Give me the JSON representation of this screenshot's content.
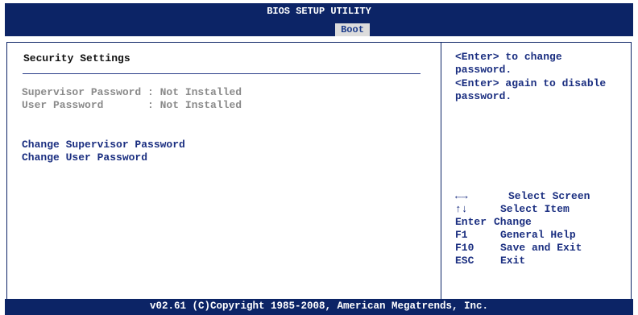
{
  "header": {
    "title": "BIOS SETUP UTILITY",
    "active_tab": "Boot"
  },
  "main": {
    "section_title": "Security Settings",
    "info": [
      "Supervisor Password : Not Installed",
      "User Password       : Not Installed"
    ],
    "menu_items": [
      "Change Supervisor Password",
      "Change User Password"
    ]
  },
  "help": {
    "line1": "<Enter> to change password.",
    "line2": "<Enter> again to disable password."
  },
  "keys": [
    {
      "key": "←→",
      "desc": "Select Screen",
      "icon": "left-right-arrows-icon"
    },
    {
      "key": "↑↓",
      "desc": "Select Item",
      "icon": "up-down-arrows-icon"
    },
    {
      "key": "Enter",
      "desc": "Change"
    },
    {
      "key": "F1",
      "desc": "General Help"
    },
    {
      "key": "F10",
      "desc": "Save and Exit"
    },
    {
      "key": "ESC",
      "desc": "Exit"
    }
  ],
  "footer": {
    "copyright": "v02.61 (C)Copyright 1985-2008, American Megatrends, Inc."
  },
  "colors": {
    "bar": "#0c2466",
    "menu_text": "#1a2e80",
    "disabled_text": "#8a8a8a",
    "tab_bg": "#dcdcdc"
  }
}
